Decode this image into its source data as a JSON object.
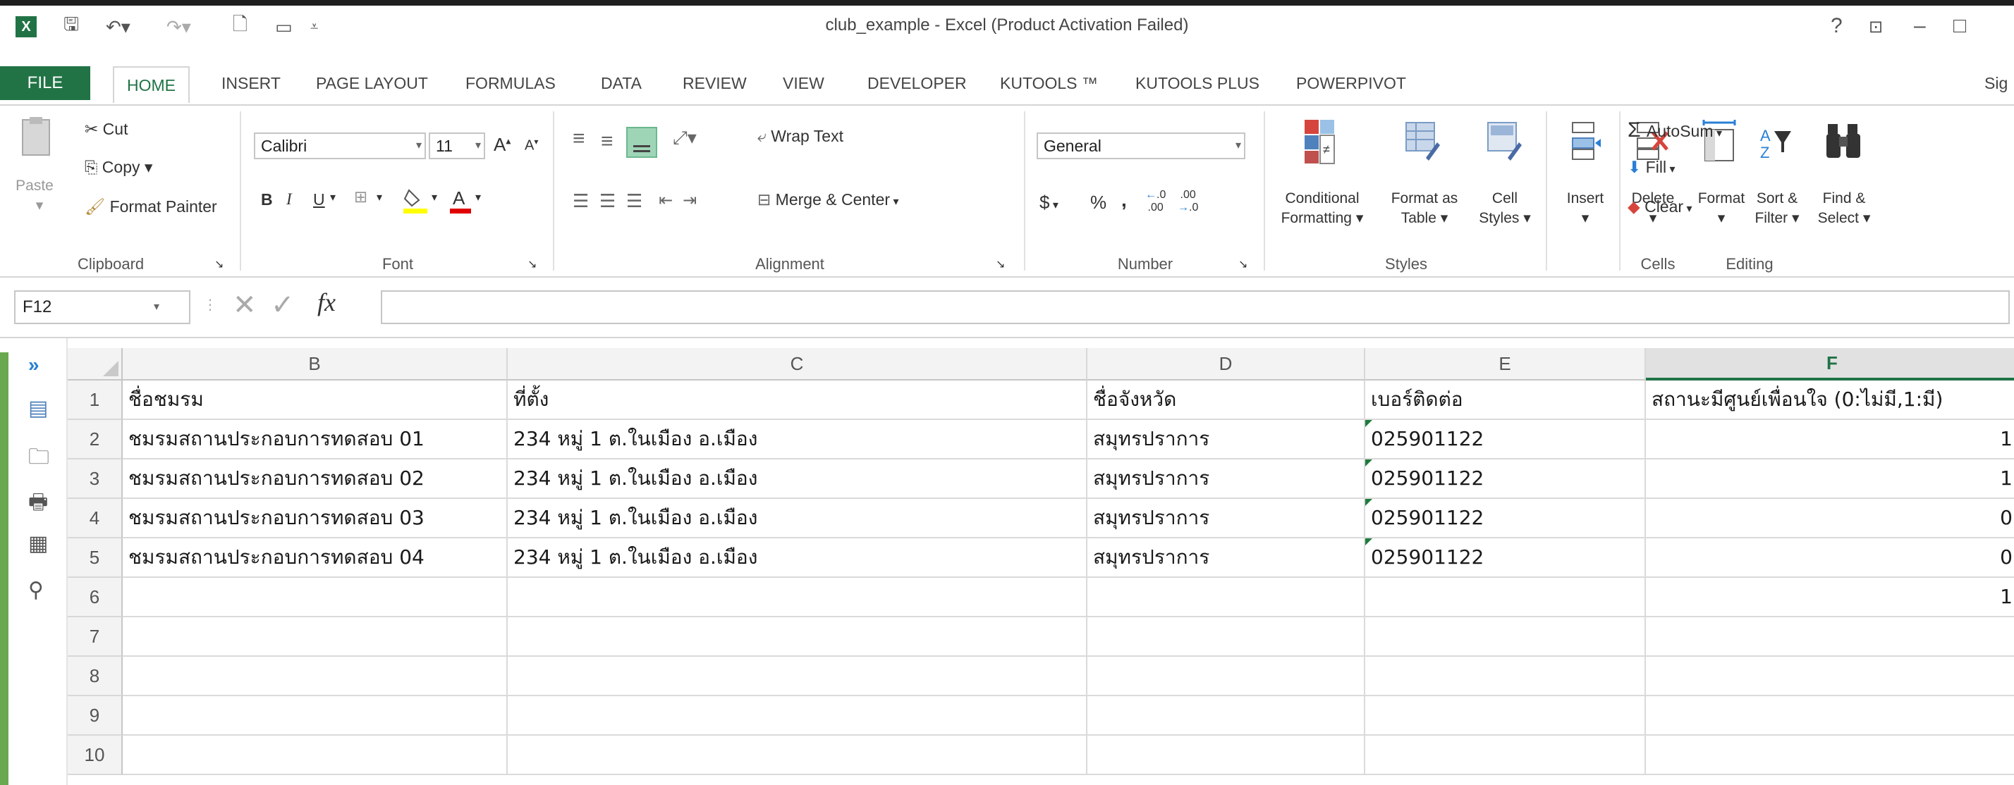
{
  "window": {
    "title": "club_example - Excel (Product Activation Failed)",
    "help": "?",
    "minimize": "–",
    "maximize": "□"
  },
  "ribbon_tabs": {
    "file": "FILE",
    "tabs": [
      "HOME",
      "INSERT",
      "PAGE LAYOUT",
      "FORMULAS",
      "DATA",
      "REVIEW",
      "VIEW",
      "DEVELOPER",
      "KUTOOLS ™",
      "KUTOOLS PLUS",
      "POWERPIVOT"
    ],
    "signin": "Sig"
  },
  "clipboard": {
    "paste": "Paste",
    "cut": "Cut",
    "copy": "Copy",
    "format_painter": "Format Painter",
    "label": "Clipboard"
  },
  "font": {
    "name": "Calibri",
    "size": "11",
    "bold": "B",
    "italic": "I",
    "underline": "U",
    "grow": "A",
    "shrink": "A",
    "label": "Font"
  },
  "alignment": {
    "wrap_text": "Wrap Text",
    "merge_center": "Merge & Center",
    "label": "Alignment"
  },
  "number": {
    "format": "General",
    "currency": "$",
    "percent": "%",
    "comma": ",",
    "inc_decimal": ".00",
    "dec_decimal": ".0",
    "label": "Number"
  },
  "styles": {
    "conditional_1": "Conditional",
    "conditional_2": "Formatting",
    "format_table_1": "Format as",
    "format_table_2": "Table",
    "cell_styles_1": "Cell",
    "cell_styles_2": "Styles",
    "label": "Styles"
  },
  "cells": {
    "insert": "Insert",
    "delete": "Delete",
    "format": "Format",
    "label": "Cells"
  },
  "editing": {
    "autosum": "AutoSum",
    "fill": "Fill",
    "clear": "Clear",
    "sort_1": "Sort &",
    "sort_2": "Filter",
    "find_1": "Find &",
    "find_2": "Select",
    "label": "Editing"
  },
  "formula_bar": {
    "name_box": "F12",
    "fx": "fx",
    "value": ""
  },
  "sheet": {
    "columns": [
      "B",
      "C",
      "D",
      "E",
      "F"
    ],
    "selected_column": "F",
    "row_numbers": [
      "1",
      "2",
      "3",
      "4",
      "5",
      "6",
      "7",
      "8",
      "9",
      "10"
    ],
    "rows": [
      [
        "ชื่อชมรม",
        "ที่ตั้ง",
        "ชื่อจังหวัด",
        "เบอร์ติดต่อ",
        "สถานะมีศูนย์เพื่อนใจ (0:ไม่มี,1:มี)"
      ],
      [
        "ชมรมสถานประกอบการทดสอบ 01",
        "234 หมู่ 1 ต.ในเมือง อ.เมือง",
        "สมุทรปราการ",
        "025901122",
        "1"
      ],
      [
        "ชมรมสถานประกอบการทดสอบ 02",
        "234 หมู่ 1 ต.ในเมือง อ.เมือง",
        "สมุทรปราการ",
        "025901122",
        "1"
      ],
      [
        "ชมรมสถานประกอบการทดสอบ 03",
        "234 หมู่ 1 ต.ในเมือง อ.เมือง",
        "สมุทรปราการ",
        "025901122",
        "0"
      ],
      [
        "ชมรมสถานประกอบการทดสอบ 04",
        "234 หมู่ 1 ต.ในเมือง อ.เมือง",
        "สมุทรปราการ",
        "025901122",
        "0"
      ],
      [
        "",
        "",
        "",
        "",
        "1"
      ],
      [
        "",
        "",
        "",
        "",
        ""
      ],
      [
        "",
        "",
        "",
        "",
        ""
      ],
      [
        "",
        "",
        "",
        "",
        ""
      ],
      [
        "",
        "",
        "",
        "",
        ""
      ]
    ]
  },
  "sidebar_icons": [
    "expand-icon",
    "table-icon",
    "folder-icon",
    "printer-icon",
    "grid-icon",
    "binoculars-icon"
  ],
  "colors": {
    "accent": "#217346",
    "text_number_marker": "#1e7b3c"
  }
}
